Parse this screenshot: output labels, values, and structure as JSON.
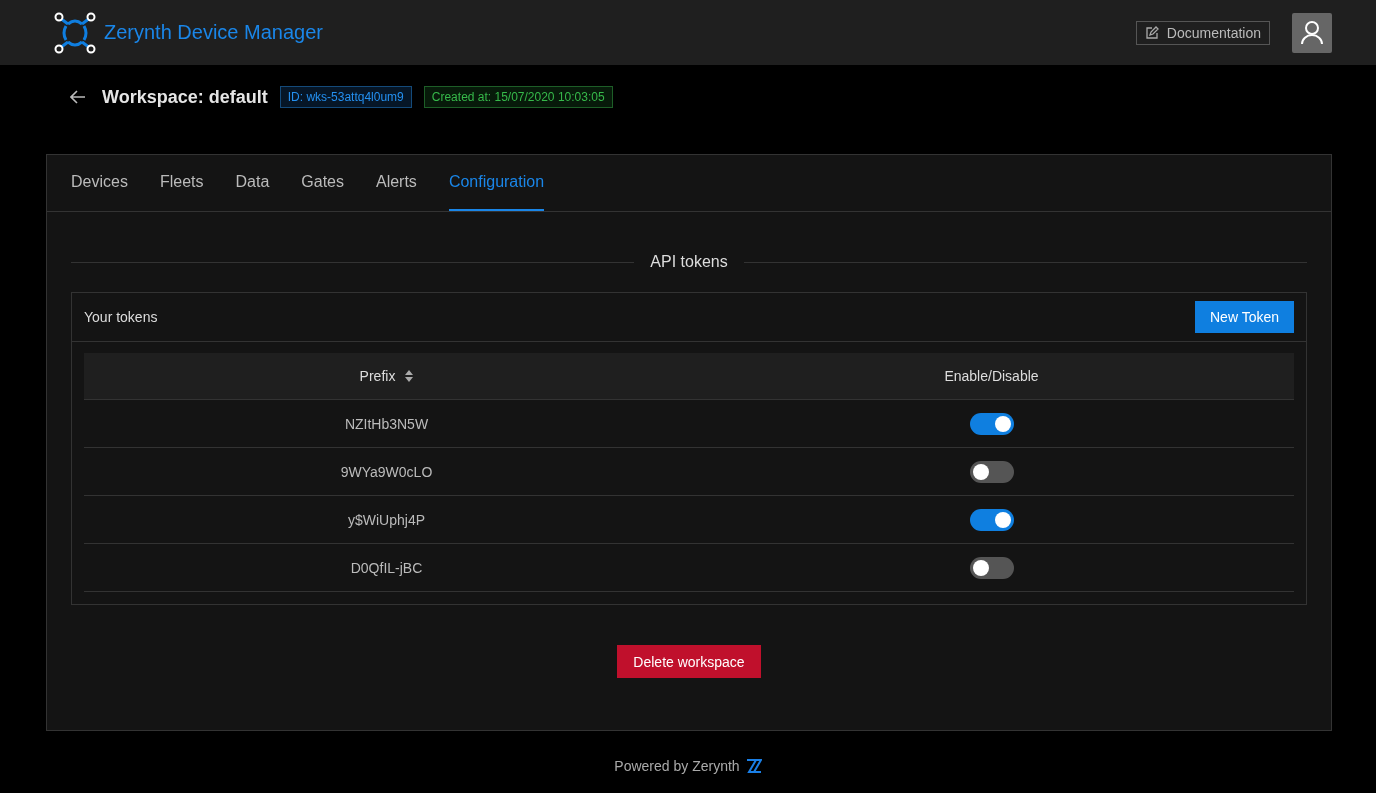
{
  "app": {
    "title": "Zerynth Device Manager"
  },
  "header": {
    "documentation": "Documentation"
  },
  "workspace": {
    "title": "Workspace: default",
    "id_badge": "ID: wks-53attq4l0um9",
    "created_badge": "Created at: 15/07/2020 10:03:05"
  },
  "tabs": [
    {
      "label": "Devices",
      "selected": false
    },
    {
      "label": "Fleets",
      "selected": false
    },
    {
      "label": "Data",
      "selected": false
    },
    {
      "label": "Gates",
      "selected": false
    },
    {
      "label": "Alerts",
      "selected": false
    },
    {
      "label": "Configuration",
      "selected": true
    }
  ],
  "section_title": "API tokens",
  "tokens_panel": {
    "title": "Your tokens",
    "new_button": "New Token"
  },
  "table": {
    "columns": [
      "Prefix",
      "Enable/Disable"
    ],
    "rows": [
      {
        "prefix": "NZItHb3N5W",
        "on": true
      },
      {
        "prefix": "9WYa9W0cLO",
        "on": false
      },
      {
        "prefix": "y$WiUphj4P",
        "on": true
      },
      {
        "prefix": "D0QfIL-jBC",
        "on": false
      }
    ]
  },
  "delete_button": "Delete workspace",
  "footer": "Powered by Zerynth"
}
